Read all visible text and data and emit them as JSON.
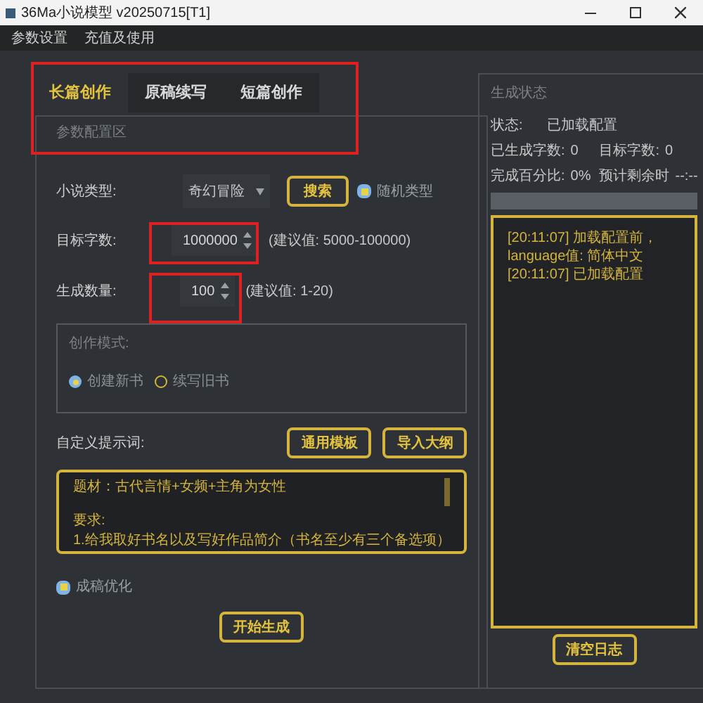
{
  "window": {
    "title": "36Ma小说模型 v20250715[T1]"
  },
  "menu": [
    "参数设置",
    "充值及使用"
  ],
  "tabs": [
    {
      "label": "长篇创作",
      "selected": true
    },
    {
      "label": "原稿续写",
      "selected": false
    },
    {
      "label": "短篇创作",
      "selected": false
    }
  ],
  "config": {
    "title": "参数配置区",
    "genre": {
      "label": "小说类型:",
      "value": "奇幻冒险",
      "search_button": "搜索",
      "random": {
        "label": "随机类型",
        "checked": true
      }
    },
    "target_words": {
      "label": "目标字数:",
      "value": "1000000",
      "hint": "(建议值: 5000-100000)"
    },
    "count": {
      "label": "生成数量:",
      "value": "100",
      "hint": "(建议值: 1-20)"
    },
    "mode": {
      "title": "创作模式:",
      "options": [
        {
          "label": "创建新书",
          "selected": true
        },
        {
          "label": "续写旧书",
          "selected": false
        }
      ]
    },
    "prompt": {
      "label": "自定义提示词:",
      "buttons": [
        "通用模板",
        "导入大纲"
      ],
      "paragraphs": [
        [
          "题材：古代言情+女频+主角为女性"
        ],
        [
          "要求:",
          "1.给我取好书名以及写好作品简介（书名至少有三个备选项）"
        ]
      ]
    },
    "optimize": {
      "label": "成稿优化",
      "checked": true
    },
    "start_button": "开始生成"
  },
  "status": {
    "title": "生成状态",
    "fields": [
      {
        "label": "状态:",
        "value": "已加载配置"
      },
      {
        "label": "已生成字数:",
        "value": "0"
      },
      {
        "label": "目标字数:",
        "value": "0"
      },
      {
        "label": "完成百分比:",
        "value": "0%"
      },
      {
        "label": "预计剩余时",
        "value": "--:--"
      }
    ],
    "progress": {
      "level": 0
    },
    "log": [
      "[20:11:07] 加载配置前，language值: 简体中文",
      "[20:11:07] 已加载配置"
    ],
    "clear_button": "清空日志"
  }
}
